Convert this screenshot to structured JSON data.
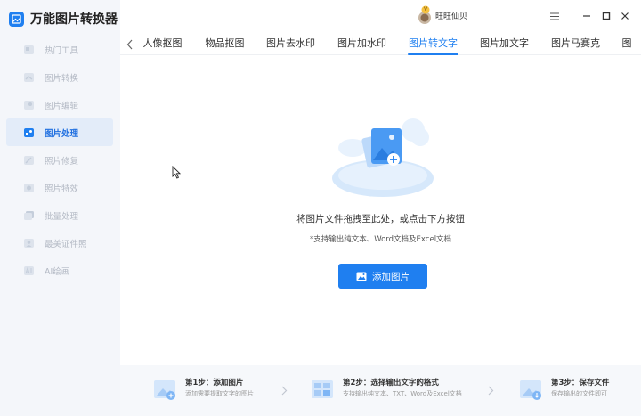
{
  "app": {
    "title": "万能图片转换器"
  },
  "sidebar": {
    "items": [
      {
        "label": "热门工具",
        "icon": "hot-tools-icon",
        "active": false
      },
      {
        "label": "图片转换",
        "icon": "image-convert-icon",
        "active": false
      },
      {
        "label": "图片编辑",
        "icon": "image-edit-icon",
        "active": false
      },
      {
        "label": "图片处理",
        "icon": "image-process-icon",
        "active": true
      },
      {
        "label": "照片修复",
        "icon": "photo-repair-icon",
        "active": false
      },
      {
        "label": "照片特效",
        "icon": "photo-effects-icon",
        "active": false
      },
      {
        "label": "批量处理",
        "icon": "batch-process-icon",
        "active": false
      },
      {
        "label": "最美证件照",
        "icon": "id-photo-icon",
        "active": false
      },
      {
        "label": "AI绘画",
        "icon": "ai-painting-icon",
        "active": false
      }
    ]
  },
  "titlebar": {
    "user_name": "旺旺仙贝",
    "vip_badge": "V"
  },
  "tabs": {
    "items": [
      "人像抠图",
      "物品抠图",
      "图片去水印",
      "图片加水印",
      "图片转文字",
      "图片加文字",
      "图片马赛克",
      "图"
    ],
    "active_index": 4
  },
  "upload": {
    "main_text": "将图片文件拖拽至此处，或点击下方按钮",
    "sub_text": "*支持输出纯文本、Word文档及Excel文档",
    "button_label": "添加图片"
  },
  "steps": [
    {
      "title": "第1步：添加图片",
      "desc": "添加需要提取文字的图片"
    },
    {
      "title": "第2步：选择输出文字的格式",
      "desc": "支持输出纯文本、TXT、Word及Excel文档"
    },
    {
      "title": "第3步：保存文件",
      "desc": "保存输出的文件即可"
    }
  ],
  "colors": {
    "accent": "#1f7ff0",
    "sidebar_bg": "#f4f6fa",
    "active_item_bg": "#e3ecf9"
  }
}
